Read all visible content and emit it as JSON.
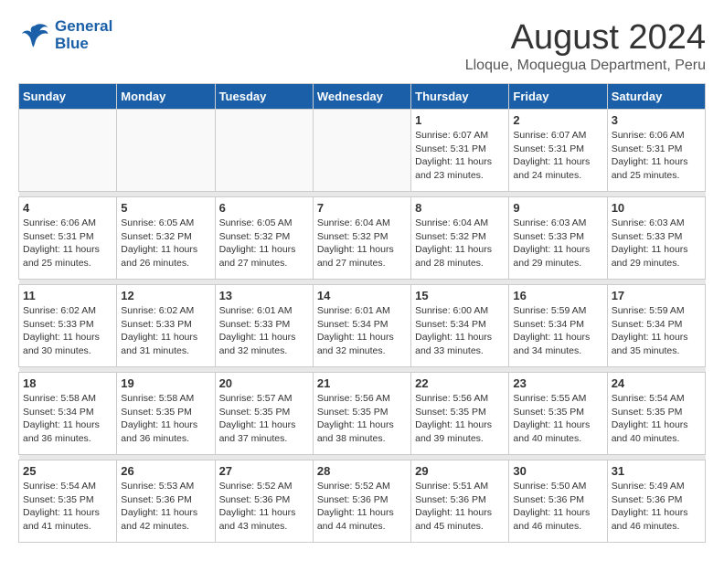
{
  "header": {
    "logo": {
      "line1": "General",
      "line2": "Blue"
    },
    "title": "August 2024",
    "subtitle": "Lloque, Moquegua Department, Peru"
  },
  "calendar": {
    "weekdays": [
      "Sunday",
      "Monday",
      "Tuesday",
      "Wednesday",
      "Thursday",
      "Friday",
      "Saturday"
    ],
    "weeks": [
      [
        {
          "day": "",
          "info": ""
        },
        {
          "day": "",
          "info": ""
        },
        {
          "day": "",
          "info": ""
        },
        {
          "day": "",
          "info": ""
        },
        {
          "day": "1",
          "info": "Sunrise: 6:07 AM\nSunset: 5:31 PM\nDaylight: 11 hours\nand 23 minutes."
        },
        {
          "day": "2",
          "info": "Sunrise: 6:07 AM\nSunset: 5:31 PM\nDaylight: 11 hours\nand 24 minutes."
        },
        {
          "day": "3",
          "info": "Sunrise: 6:06 AM\nSunset: 5:31 PM\nDaylight: 11 hours\nand 25 minutes."
        }
      ],
      [
        {
          "day": "4",
          "info": "Sunrise: 6:06 AM\nSunset: 5:31 PM\nDaylight: 11 hours\nand 25 minutes."
        },
        {
          "day": "5",
          "info": "Sunrise: 6:05 AM\nSunset: 5:32 PM\nDaylight: 11 hours\nand 26 minutes."
        },
        {
          "day": "6",
          "info": "Sunrise: 6:05 AM\nSunset: 5:32 PM\nDaylight: 11 hours\nand 27 minutes."
        },
        {
          "day": "7",
          "info": "Sunrise: 6:04 AM\nSunset: 5:32 PM\nDaylight: 11 hours\nand 27 minutes."
        },
        {
          "day": "8",
          "info": "Sunrise: 6:04 AM\nSunset: 5:32 PM\nDaylight: 11 hours\nand 28 minutes."
        },
        {
          "day": "9",
          "info": "Sunrise: 6:03 AM\nSunset: 5:33 PM\nDaylight: 11 hours\nand 29 minutes."
        },
        {
          "day": "10",
          "info": "Sunrise: 6:03 AM\nSunset: 5:33 PM\nDaylight: 11 hours\nand 29 minutes."
        }
      ],
      [
        {
          "day": "11",
          "info": "Sunrise: 6:02 AM\nSunset: 5:33 PM\nDaylight: 11 hours\nand 30 minutes."
        },
        {
          "day": "12",
          "info": "Sunrise: 6:02 AM\nSunset: 5:33 PM\nDaylight: 11 hours\nand 31 minutes."
        },
        {
          "day": "13",
          "info": "Sunrise: 6:01 AM\nSunset: 5:33 PM\nDaylight: 11 hours\nand 32 minutes."
        },
        {
          "day": "14",
          "info": "Sunrise: 6:01 AM\nSunset: 5:34 PM\nDaylight: 11 hours\nand 32 minutes."
        },
        {
          "day": "15",
          "info": "Sunrise: 6:00 AM\nSunset: 5:34 PM\nDaylight: 11 hours\nand 33 minutes."
        },
        {
          "day": "16",
          "info": "Sunrise: 5:59 AM\nSunset: 5:34 PM\nDaylight: 11 hours\nand 34 minutes."
        },
        {
          "day": "17",
          "info": "Sunrise: 5:59 AM\nSunset: 5:34 PM\nDaylight: 11 hours\nand 35 minutes."
        }
      ],
      [
        {
          "day": "18",
          "info": "Sunrise: 5:58 AM\nSunset: 5:34 PM\nDaylight: 11 hours\nand 36 minutes."
        },
        {
          "day": "19",
          "info": "Sunrise: 5:58 AM\nSunset: 5:35 PM\nDaylight: 11 hours\nand 36 minutes."
        },
        {
          "day": "20",
          "info": "Sunrise: 5:57 AM\nSunset: 5:35 PM\nDaylight: 11 hours\nand 37 minutes."
        },
        {
          "day": "21",
          "info": "Sunrise: 5:56 AM\nSunset: 5:35 PM\nDaylight: 11 hours\nand 38 minutes."
        },
        {
          "day": "22",
          "info": "Sunrise: 5:56 AM\nSunset: 5:35 PM\nDaylight: 11 hours\nand 39 minutes."
        },
        {
          "day": "23",
          "info": "Sunrise: 5:55 AM\nSunset: 5:35 PM\nDaylight: 11 hours\nand 40 minutes."
        },
        {
          "day": "24",
          "info": "Sunrise: 5:54 AM\nSunset: 5:35 PM\nDaylight: 11 hours\nand 40 minutes."
        }
      ],
      [
        {
          "day": "25",
          "info": "Sunrise: 5:54 AM\nSunset: 5:35 PM\nDaylight: 11 hours\nand 41 minutes."
        },
        {
          "day": "26",
          "info": "Sunrise: 5:53 AM\nSunset: 5:36 PM\nDaylight: 11 hours\nand 42 minutes."
        },
        {
          "day": "27",
          "info": "Sunrise: 5:52 AM\nSunset: 5:36 PM\nDaylight: 11 hours\nand 43 minutes."
        },
        {
          "day": "28",
          "info": "Sunrise: 5:52 AM\nSunset: 5:36 PM\nDaylight: 11 hours\nand 44 minutes."
        },
        {
          "day": "29",
          "info": "Sunrise: 5:51 AM\nSunset: 5:36 PM\nDaylight: 11 hours\nand 45 minutes."
        },
        {
          "day": "30",
          "info": "Sunrise: 5:50 AM\nSunset: 5:36 PM\nDaylight: 11 hours\nand 46 minutes."
        },
        {
          "day": "31",
          "info": "Sunrise: 5:49 AM\nSunset: 5:36 PM\nDaylight: 11 hours\nand 46 minutes."
        }
      ]
    ]
  }
}
